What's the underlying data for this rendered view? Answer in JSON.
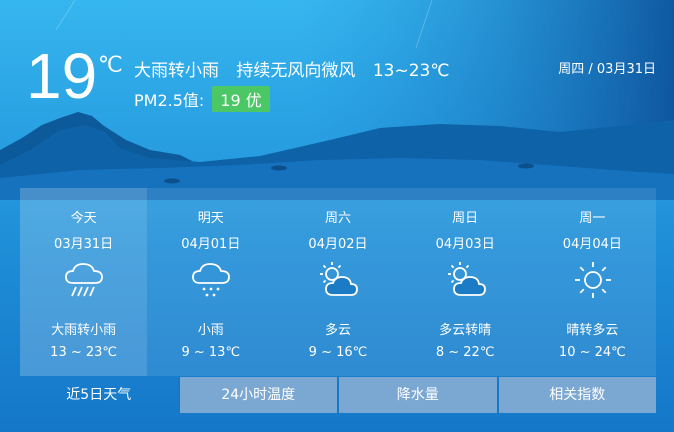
{
  "current": {
    "temperature": "19",
    "unit": "℃",
    "condition": "大雨转小雨",
    "wind": "持续无风向微风",
    "range": "13~23℃",
    "pm_label": "PM2.5值:",
    "aqi": "19 优",
    "date": "周四 / 03月31日"
  },
  "forecast": [
    {
      "name": "今天",
      "date": "03月31日",
      "icon": "heavy-rain-icon",
      "desc": "大雨转小雨",
      "range": "13 ~ 23℃"
    },
    {
      "name": "明天",
      "date": "04月01日",
      "icon": "light-rain-icon",
      "desc": "小雨",
      "range": "9 ~ 13℃"
    },
    {
      "name": "周六",
      "date": "04月02日",
      "icon": "partly-cloudy-icon",
      "desc": "多云",
      "range": "9 ~ 16℃"
    },
    {
      "name": "周日",
      "date": "04月03日",
      "icon": "partly-cloudy-icon",
      "desc": "多云转晴",
      "range": "8 ~ 22℃"
    },
    {
      "name": "周一",
      "date": "04月04日",
      "icon": "sun-icon",
      "desc": "晴转多云",
      "range": "10 ~ 24℃"
    }
  ],
  "tabs": [
    "近5日天气",
    "24小时温度",
    "降水量",
    "相关指数"
  ],
  "colors": {
    "aqi_good": "#4cc765",
    "tab_inactive": "#7ba7d3"
  }
}
